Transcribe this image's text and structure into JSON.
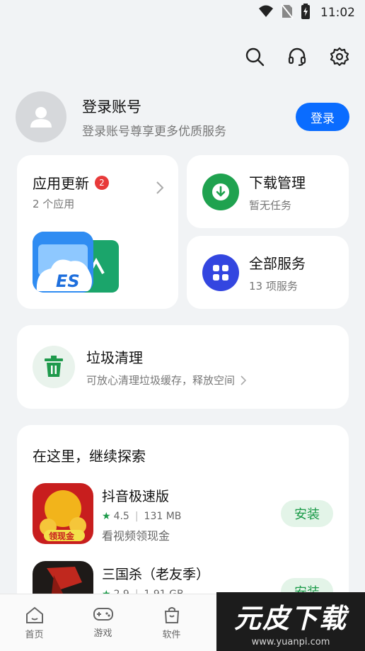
{
  "status_bar": {
    "time": "11:02"
  },
  "account": {
    "title": "登录账号",
    "subtitle": "登录账号尊享更多优质服务",
    "login_label": "登录"
  },
  "updates": {
    "title": "应用更新",
    "badge": "2",
    "subtitle": "2 个应用",
    "app_icon_text": "ES"
  },
  "download": {
    "title": "下载管理",
    "subtitle": "暂无任务"
  },
  "services": {
    "title": "全部服务",
    "subtitle": "13 项服务"
  },
  "clean": {
    "title": "垃圾清理",
    "subtitle": "可放心清理垃圾缓存，释放空间"
  },
  "explore": {
    "title": "在这里，继续探索",
    "apps": [
      {
        "name": "抖音极速版",
        "rating": "4.5",
        "size": "131 MB",
        "description": "看视频领现金",
        "icon_text": "领现金",
        "install_label": "安装"
      },
      {
        "name": "三国杀（老友季）",
        "rating": "2.9",
        "size": "1.91 GB",
        "install_label": "安装"
      }
    ]
  },
  "bottom_nav": {
    "items": [
      {
        "label": "首页"
      },
      {
        "label": "游戏"
      },
      {
        "label": "软件"
      }
    ]
  },
  "watermark": {
    "main": "元皮下载",
    "sub": "www.yuanpi.com"
  },
  "colors": {
    "accent": "#0a6cff",
    "green": "#1a9a48",
    "badge_red": "#e83a3a",
    "services_blue": "#3346e0"
  }
}
